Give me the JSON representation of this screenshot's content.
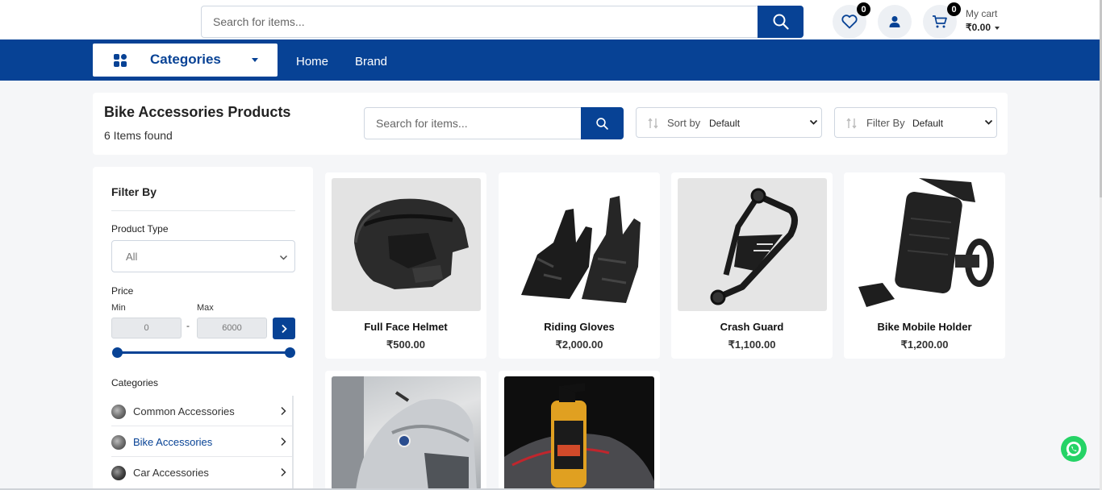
{
  "header": {
    "search_placeholder": "Search for items...",
    "wishlist_count": "0",
    "cart_count": "0",
    "cart_label": "My cart",
    "cart_total": "₹0.00"
  },
  "nav": {
    "categories_label": "Categories",
    "links": [
      "Home",
      "Brand"
    ]
  },
  "page": {
    "title": "Bike Accessories Products",
    "items_found": "6 Items found",
    "search_placeholder": "Search for items...",
    "sort_label": "Sort by",
    "sort_value": "Default",
    "filter_label": "Filter By",
    "filter_value": "Default"
  },
  "sidebar": {
    "title": "Filter By",
    "product_type_label": "Product Type",
    "product_type_value": "All",
    "price_label": "Price",
    "min_label": "Min",
    "max_label": "Max",
    "min_value": "0",
    "max_value": "6000",
    "dash": "-",
    "categories_label": "Categories",
    "categories": [
      {
        "name": "Common Accessories",
        "active": false
      },
      {
        "name": "Bike Accessories",
        "active": true
      },
      {
        "name": "Car Accessories",
        "active": false
      }
    ]
  },
  "products": [
    {
      "name": "Full Face Helmet",
      "price": "₹500.00",
      "icon": "helmet-image"
    },
    {
      "name": "Riding Gloves",
      "price": "₹2,000.00",
      "icon": "gloves-image"
    },
    {
      "name": "Crash Guard",
      "price": "₹1,100.00",
      "icon": "crash-guard-image"
    },
    {
      "name": "Bike Mobile Holder",
      "price": "₹1,200.00",
      "icon": "mobile-holder-image"
    },
    {
      "name": "",
      "price": "",
      "icon": "motorcycle-image"
    },
    {
      "name": "",
      "price": "",
      "icon": "cleaner-spray-image"
    }
  ],
  "colors": {
    "brand_blue": "#074295",
    "whatsapp_green": "#25d366"
  }
}
